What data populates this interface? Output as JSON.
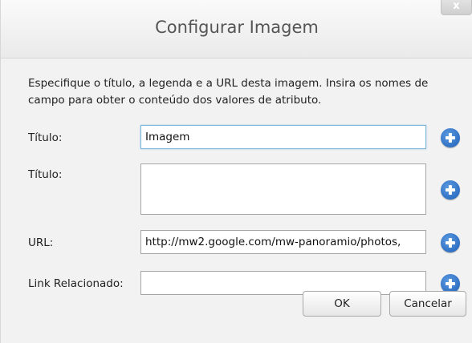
{
  "dialog": {
    "title": "Configurar Imagem",
    "close_label": "x",
    "description": "Especifique o título, a legenda e a URL desta imagem. Insira os nomes de campo para obter o conteúdo dos valores de atributo."
  },
  "fields": {
    "titulo1": {
      "label": "Título:",
      "value": "Imagem"
    },
    "titulo2": {
      "label": "Título:",
      "value": ""
    },
    "url": {
      "label": "URL:",
      "value": "http://mw2.google.com/mw-panoramio/photos,"
    },
    "link": {
      "label": "Link Relacionado:",
      "value": ""
    }
  },
  "buttons": {
    "ok": "OK",
    "cancel": "Cancelar"
  },
  "icons": {
    "add": "plus-circle-icon",
    "close": "close-icon"
  },
  "colors": {
    "add_icon": "#2a6cc4",
    "focus_border": "#7fb7d9"
  }
}
